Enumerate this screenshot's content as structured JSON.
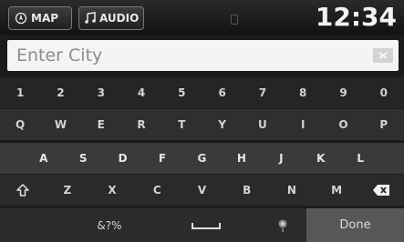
{
  "topbar": {
    "map_label": "MAP",
    "audio_label": "AUDIO",
    "clock": "12:34"
  },
  "search": {
    "placeholder": "Enter City",
    "value": ""
  },
  "keyboard": {
    "row1": [
      "1",
      "2",
      "3",
      "4",
      "5",
      "6",
      "7",
      "8",
      "9",
      "0"
    ],
    "row2": [
      "Q",
      "W",
      "E",
      "R",
      "T",
      "Y",
      "U",
      "I",
      "O",
      "P"
    ],
    "row3": [
      "A",
      "S",
      "D",
      "F",
      "G",
      "H",
      "J",
      "K",
      "L"
    ],
    "row4": [
      "Z",
      "X",
      "C",
      "V",
      "B",
      "N",
      "M"
    ],
    "symbols_label": "&?%",
    "done_label": "Done"
  }
}
